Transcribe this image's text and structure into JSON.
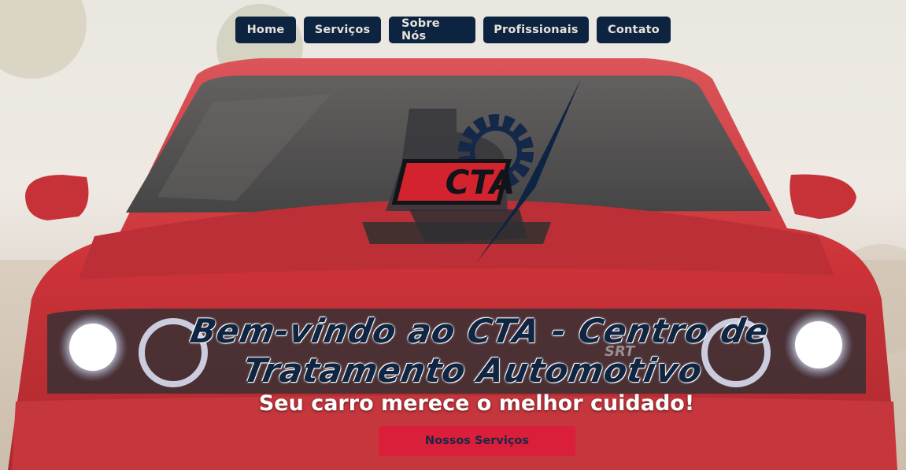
{
  "nav": {
    "items": [
      {
        "label": "Home"
      },
      {
        "label": "Serviços"
      },
      {
        "label": "Sobre Nós"
      },
      {
        "label": "Profissionais"
      },
      {
        "label": "Contato"
      }
    ]
  },
  "logo": {
    "text": "CTA",
    "icon": "cta-gear-check-logo"
  },
  "hero": {
    "title": "Bem-vindo ao CTA - Centro de Tratamento Automotivo",
    "subtitle": "Seu carro merece o melhor cuidado!",
    "cta_label": "Nossos Serviços",
    "car_badge": "SRT"
  },
  "colors": {
    "nav_bg": "#0d2440",
    "nav_text": "#e7e2dc",
    "title": "#0f2542",
    "button_bg": "#d91f3a",
    "button_text": "#1a2747",
    "car_red": "#c8262b"
  }
}
